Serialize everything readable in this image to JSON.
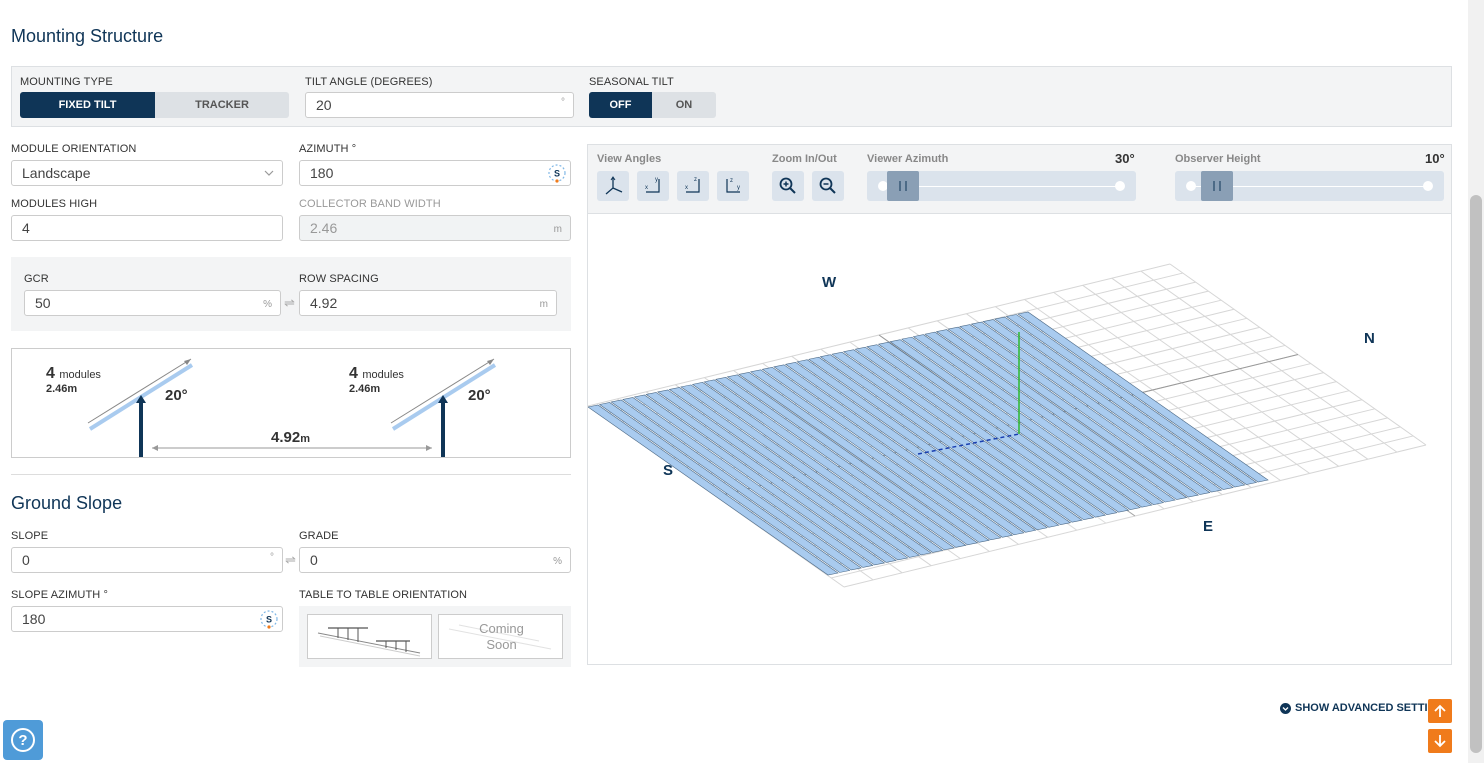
{
  "mounting": {
    "title": "Mounting Structure",
    "mounting_type_label": "MOUNTING TYPE",
    "mounting_type_options": [
      "FIXED TILT",
      "TRACKER"
    ],
    "tilt_label": "TILT ANGLE (DEGREES)",
    "tilt_value": "20",
    "tilt_unit": "°",
    "seasonal_label": "SEASONAL TILT",
    "seasonal_options": [
      "OFF",
      "ON"
    ],
    "orientation_label": "MODULE ORIENTATION",
    "orientation_value": "Landscape",
    "azimuth_label": "AZIMUTH °",
    "azimuth_value": "180",
    "modules_high_label": "MODULES HIGH",
    "modules_high_value": "4",
    "band_width_label": "COLLECTOR BAND WIDTH",
    "band_width_value": "2.46",
    "band_width_unit": "m",
    "gcr_label": "GCR",
    "gcr_value": "50",
    "gcr_unit": "%",
    "row_spacing_label": "ROW SPACING",
    "row_spacing_value": "4.92",
    "row_spacing_unit": "m"
  },
  "diagram": {
    "modules_count": "4",
    "modules_word": "modules",
    "module_len": "2.46m",
    "angle": "20°",
    "spacing": "4.92",
    "spacing_unit": "m"
  },
  "ground": {
    "title": "Ground Slope",
    "slope_label": "SLOPE",
    "slope_value": "0",
    "slope_unit": "°",
    "grade_label": "GRADE",
    "grade_value": "0",
    "grade_unit": "%",
    "slope_az_label": "SLOPE AZIMUTH °",
    "slope_az_value": "180",
    "t2t_label": "TABLE TO TABLE ORIENTATION",
    "coming_soon_1": "Coming",
    "coming_soon_2": "Soon"
  },
  "viewer": {
    "view_angles_label": "View Angles",
    "zoom_label": "Zoom In/Out",
    "viewer_azimuth_label": "Viewer Azimuth",
    "viewer_azimuth_value": "30°",
    "viewer_azimuth_fraction": 0.085,
    "observer_height_label": "Observer Height",
    "observer_height_value": "10°",
    "observer_height_fraction": 0.11,
    "dir_w": "W",
    "dir_n": "N",
    "dir_s": "S",
    "dir_e": "E"
  },
  "footer": {
    "advanced_label": "SHOW ADVANCED SETTIN"
  },
  "colors": {
    "navy": "#0f3557",
    "panel_blue": "#a9cbef",
    "accent_orange": "#f07b1b",
    "help_blue": "#4f9bd8"
  }
}
